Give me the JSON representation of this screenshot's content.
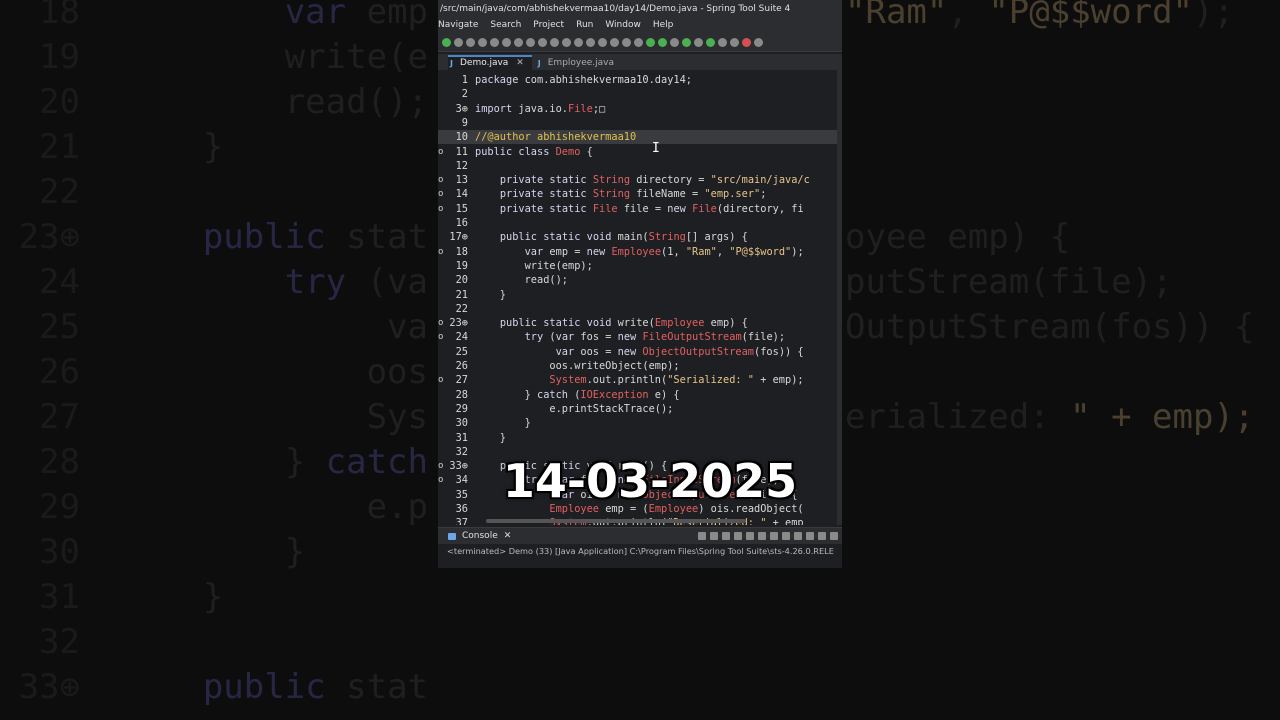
{
  "window": {
    "title": "/src/main/java/com/abhishekvermaa10/day14/Demo.java - Spring Tool Suite 4"
  },
  "menu": [
    "Navigate",
    "Search",
    "Project",
    "Run",
    "Window",
    "Help"
  ],
  "tabs": [
    {
      "label": "Demo.java",
      "active": true
    },
    {
      "label": "Employee.java",
      "active": false
    }
  ],
  "code_lines": [
    {
      "n": "1",
      "text": "package com.abhishekvermaa10.day14;"
    },
    {
      "n": "2",
      "text": ""
    },
    {
      "n": "3⊕",
      "text": "import java.io.File;□"
    },
    {
      "n": "9",
      "text": ""
    },
    {
      "n": "10",
      "text": "//@author abhishekvermaa10"
    },
    {
      "n": "11",
      "text": "public class Demo {"
    },
    {
      "n": "12",
      "text": ""
    },
    {
      "n": "13",
      "text": "    private static String directory = \"src/main/java/c"
    },
    {
      "n": "14",
      "text": "    private static String fileName = \"emp.ser\";"
    },
    {
      "n": "15",
      "text": "    private static File file = new File(directory, fi"
    },
    {
      "n": "16",
      "text": ""
    },
    {
      "n": "17⊕",
      "text": "    public static void main(String[] args) {"
    },
    {
      "n": "18",
      "text": "        var emp = new Employee(1, \"Ram\", \"P@$$word\");"
    },
    {
      "n": "19",
      "text": "        write(emp);"
    },
    {
      "n": "20",
      "text": "        read();"
    },
    {
      "n": "21",
      "text": "    }"
    },
    {
      "n": "22",
      "text": ""
    },
    {
      "n": "23⊕",
      "text": "    public static void write(Employee emp) {"
    },
    {
      "n": "24",
      "text": "        try (var fos = new FileOutputStream(file);"
    },
    {
      "n": "25",
      "text": "             var oos = new ObjectOutputStream(fos)) {"
    },
    {
      "n": "26",
      "text": "            oos.writeObject(emp);"
    },
    {
      "n": "27",
      "text": "            System.out.println(\"Serialized: \" + emp);"
    },
    {
      "n": "28",
      "text": "        } catch (IOException e) {"
    },
    {
      "n": "29",
      "text": "            e.printStackTrace();"
    },
    {
      "n": "30",
      "text": "        }"
    },
    {
      "n": "31",
      "text": "    }"
    },
    {
      "n": "32",
      "text": ""
    },
    {
      "n": "33⊕",
      "text": "    public static void read() {"
    },
    {
      "n": "34",
      "text": "        try (var fis = new FileInputStream(file);"
    },
    {
      "n": "35",
      "text": "             var ois = new ObjectInputStream(fis)) {"
    },
    {
      "n": "36",
      "text": "            Employee emp = (Employee) ois.readObject("
    },
    {
      "n": "37",
      "text": "            System.out.println(\"Deserialized: \" + emp"
    }
  ],
  "console": {
    "label": "Console",
    "status": "<terminated> Demo (33) [Java Application] C:\\Program Files\\Spring Tool Suite\\sts-4.26.0.RELE"
  },
  "overlay": {
    "date": "14-03-2025"
  },
  "backdrop_lines": [
    {
      "n": "18",
      "text": "        var emp"
    },
    {
      "n": "19",
      "text": "        write(e"
    },
    {
      "n": "20",
      "text": "        read();"
    },
    {
      "n": "21",
      "text": "    }"
    },
    {
      "n": "22",
      "text": ""
    },
    {
      "n": "23⊕",
      "text": "    public stat"
    },
    {
      "n": "24",
      "text": "        try (va"
    },
    {
      "n": "25",
      "text": "             va"
    },
    {
      "n": "26",
      "text": "            oos"
    },
    {
      "n": "27",
      "text": "            Sys"
    },
    {
      "n": "28",
      "text": "        } catch"
    },
    {
      "n": "29",
      "text": "            e.p"
    },
    {
      "n": "30",
      "text": "        }"
    },
    {
      "n": "31",
      "text": "    }"
    },
    {
      "n": "32",
      "text": ""
    },
    {
      "n": "33⊕",
      "text": "    public stat"
    }
  ],
  "backdrop_right_lines": [
    "\"Ram\", \"P@$$word\");",
    "",
    "",
    "",
    "",
    "oyee emp) {",
    "putStream(file);",
    "OutputStream(fos)) {",
    "",
    "erialized: \" + emp);"
  ]
}
